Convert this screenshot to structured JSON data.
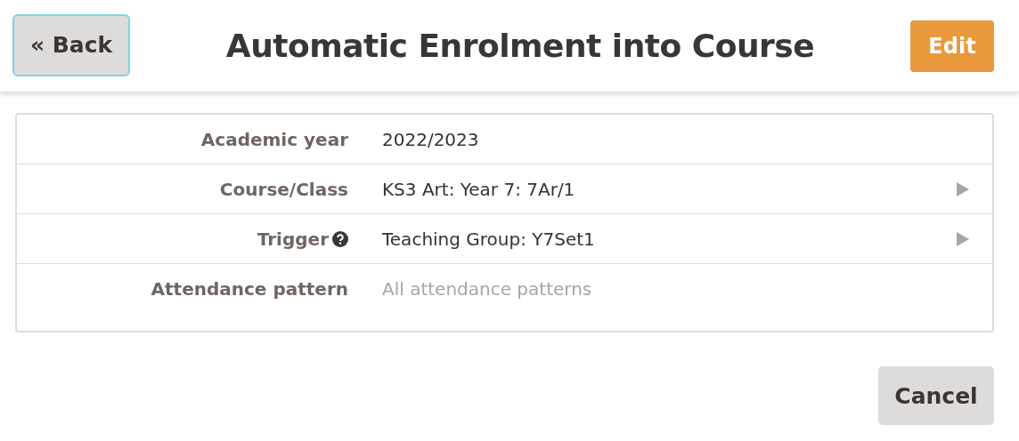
{
  "header": {
    "back_button": "« Back",
    "title": "Automatic Enrolment into Course",
    "edit_button": "Edit"
  },
  "fields": [
    {
      "label": "Academic year",
      "value": "2022/2023",
      "help": false,
      "navigable": false,
      "muted": false
    },
    {
      "label": "Course/Class",
      "value": "KS3 Art: Year 7: 7Ar/1",
      "help": false,
      "navigable": true,
      "muted": false
    },
    {
      "label": "Trigger",
      "value": "Teaching Group: Y7Set1",
      "help": true,
      "navigable": true,
      "muted": false
    },
    {
      "label": "Attendance pattern",
      "value": "All attendance patterns",
      "help": false,
      "navigable": false,
      "muted": true
    }
  ],
  "footer": {
    "cancel_button": "Cancel"
  }
}
